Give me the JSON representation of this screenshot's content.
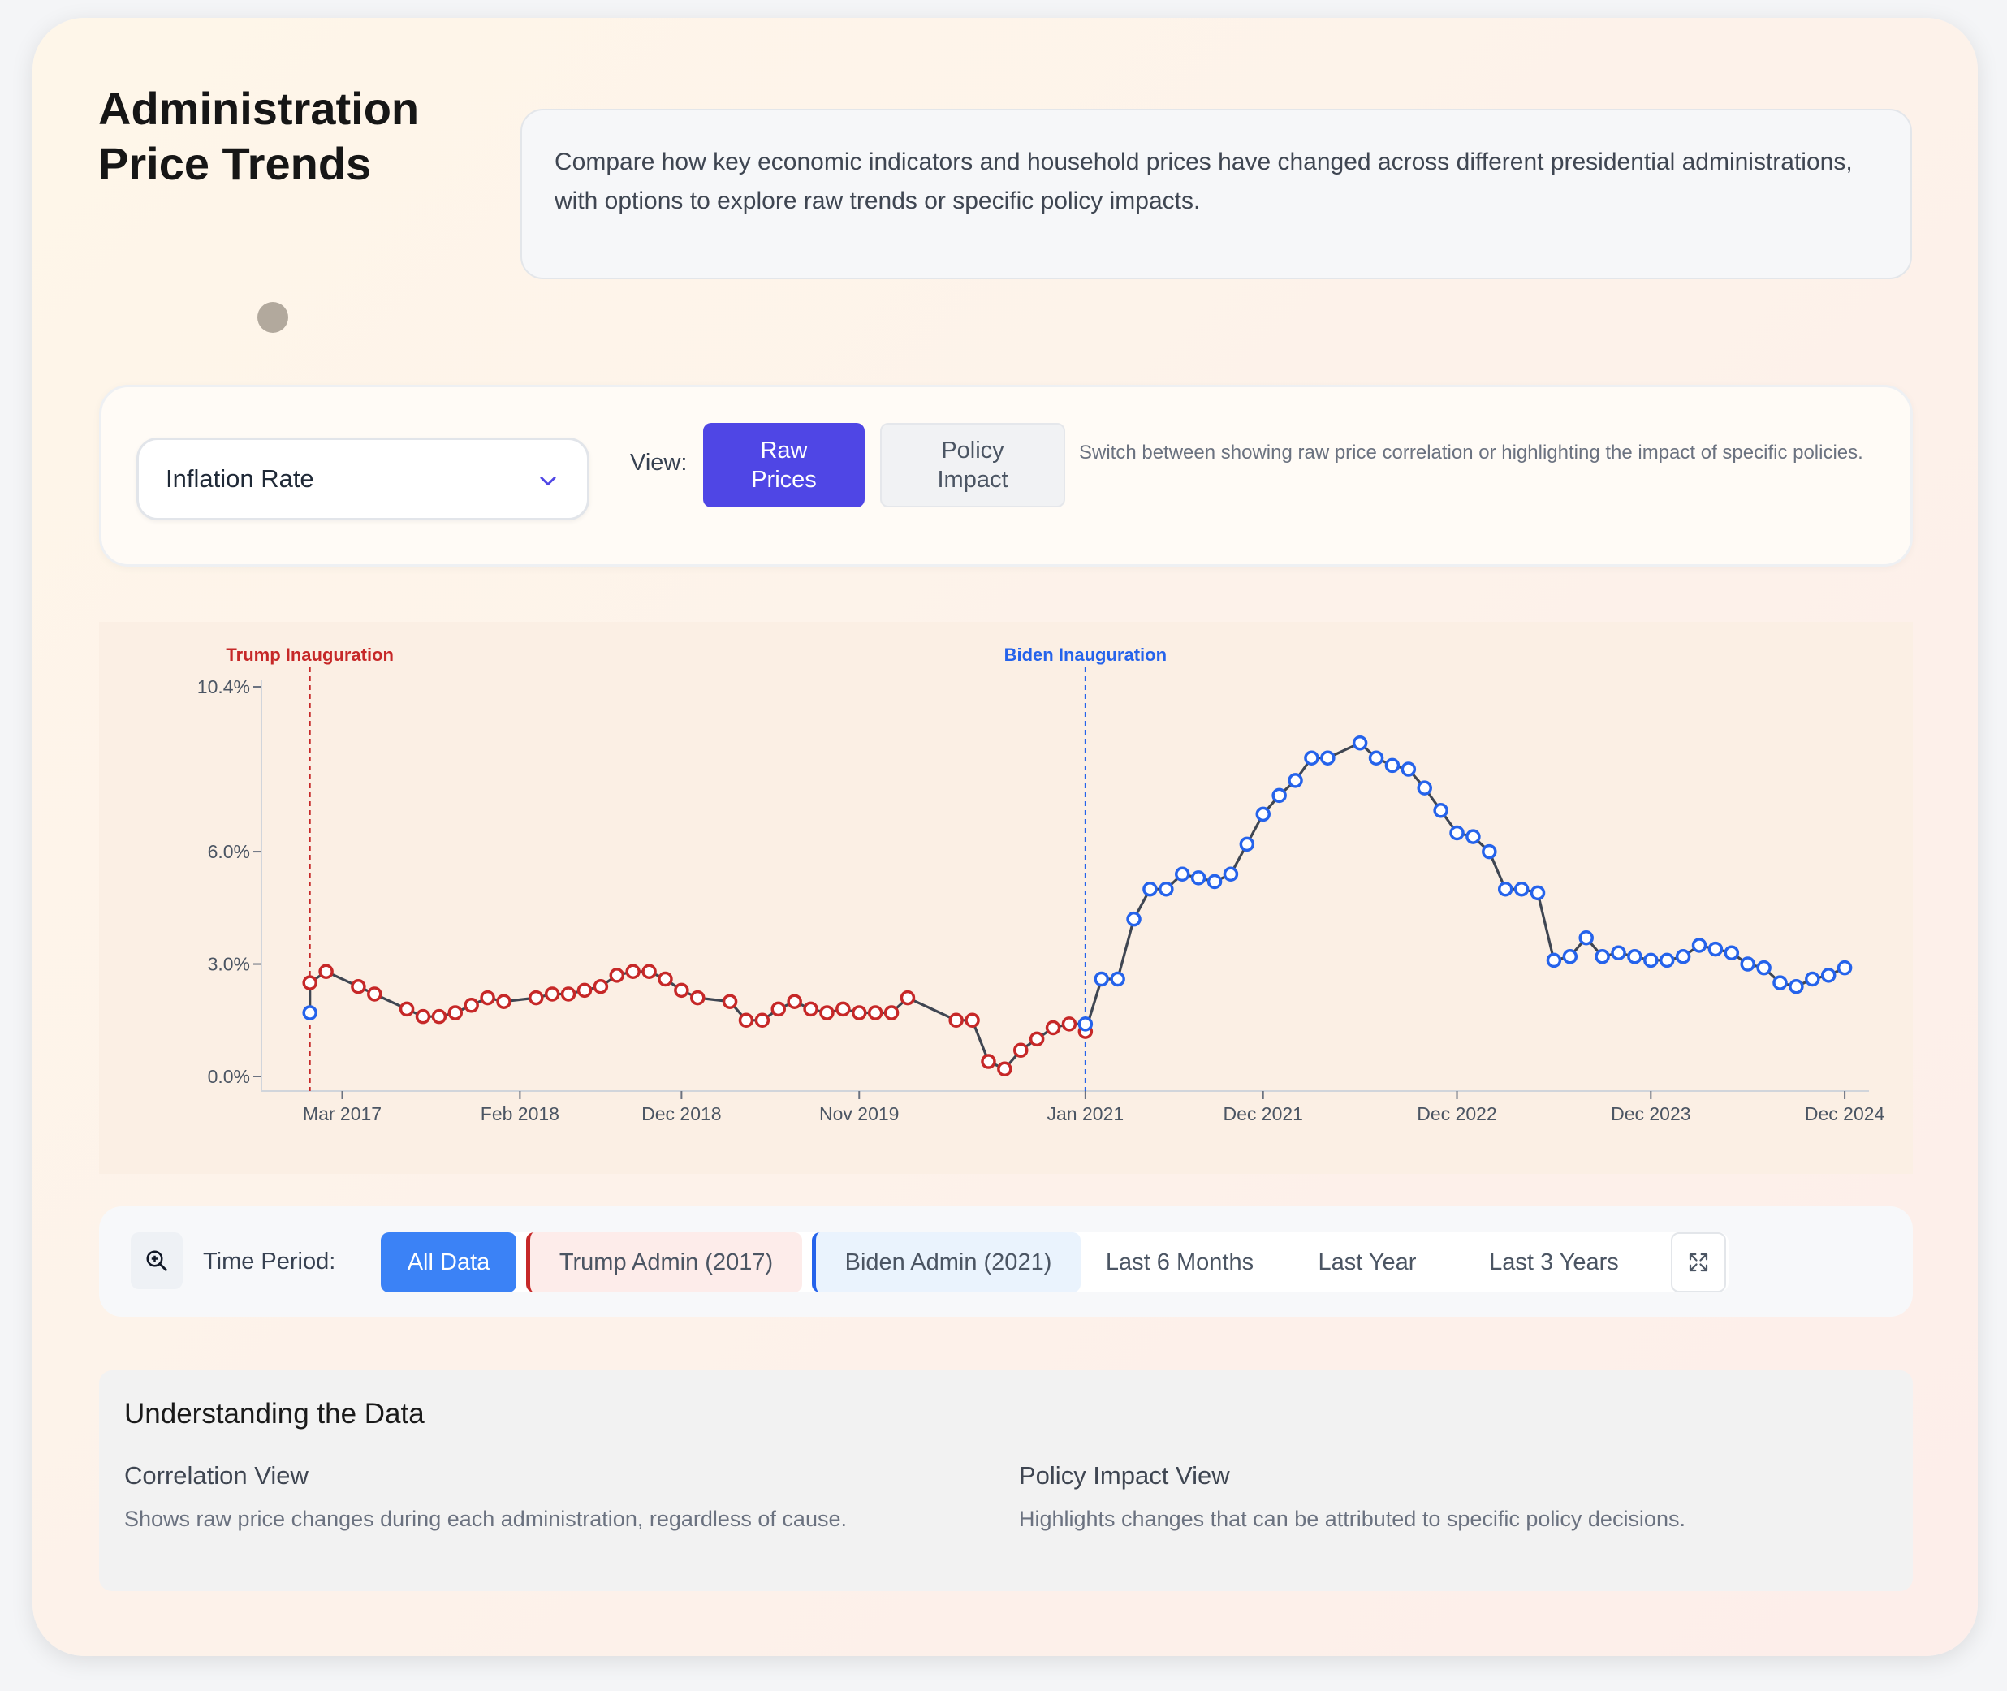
{
  "header": {
    "title_line1": "Administration",
    "title_line2": "Price Trends",
    "description": "Compare how key economic indicators and household prices have changed across different presidential administrations, with options to explore raw trends or specific policy impacts."
  },
  "controls": {
    "indicator_selected": "Inflation Rate",
    "view_label": "View:",
    "view_raw_label": "Raw\nPrices",
    "view_policy_label": "Policy\nImpact",
    "view_hint": "Switch between showing raw price correlation or highlighting the impact of specific policies."
  },
  "colors": {
    "trump": "#c62828",
    "biden": "#2563eb",
    "line": "#3f4652",
    "accent": "#4f46e5",
    "period_active": "#3b82f6"
  },
  "chart_data": {
    "type": "line",
    "title": "",
    "xlabel": "",
    "ylabel": "",
    "ylim": [
      0,
      10.4
    ],
    "y_ticks": [
      "0.0%",
      "3.0%",
      "6.0%",
      "10.4%"
    ],
    "y_tick_values": [
      0,
      3,
      6,
      10.4
    ],
    "x_ticks": [
      "Mar 2017",
      "Feb 2018",
      "Dec 2018",
      "Nov 2019",
      "Jan 2021",
      "Dec 2021",
      "Dec 2022",
      "Dec 2023",
      "Dec 2024"
    ],
    "x_tick_months": [
      "2017-03",
      "2018-02",
      "2018-12",
      "2019-11",
      "2021-01",
      "2021-12",
      "2022-12",
      "2023-12",
      "2024-12"
    ],
    "grid": false,
    "annotations": [
      {
        "label": "Trump Inauguration",
        "date": "2017-01",
        "color": "trump"
      },
      {
        "label": "Biden Inauguration",
        "date": "2021-01",
        "color": "biden"
      }
    ],
    "series": [
      {
        "admin": "trump",
        "points": [
          [
            "2017-01",
            2.5
          ],
          [
            "2017-02",
            2.8
          ],
          [
            "2017-04",
            2.4
          ],
          [
            "2017-05",
            2.2
          ],
          [
            "2017-07",
            1.8
          ],
          [
            "2017-08",
            1.6
          ],
          [
            "2017-09",
            1.6
          ],
          [
            "2017-10",
            1.7
          ],
          [
            "2017-11",
            1.9
          ],
          [
            "2017-12",
            2.1
          ],
          [
            "2018-01",
            2.0
          ],
          [
            "2018-03",
            2.1
          ],
          [
            "2018-04",
            2.2
          ],
          [
            "2018-05",
            2.2
          ],
          [
            "2018-06",
            2.3
          ],
          [
            "2018-07",
            2.4
          ],
          [
            "2018-08",
            2.7
          ],
          [
            "2018-09",
            2.8
          ],
          [
            "2018-10",
            2.8
          ],
          [
            "2018-11",
            2.6
          ],
          [
            "2018-12",
            2.3
          ],
          [
            "2019-01",
            2.1
          ],
          [
            "2019-03",
            2.0
          ],
          [
            "2019-04",
            1.5
          ],
          [
            "2019-05",
            1.5
          ],
          [
            "2019-06",
            1.8
          ],
          [
            "2019-07",
            2.0
          ],
          [
            "2019-08",
            1.8
          ],
          [
            "2019-09",
            1.7
          ],
          [
            "2019-10",
            1.8
          ],
          [
            "2019-11",
            1.7
          ],
          [
            "2019-12",
            1.7
          ],
          [
            "2020-01",
            1.7
          ],
          [
            "2020-02",
            2.1
          ],
          [
            "2020-05",
            1.5
          ],
          [
            "2020-06",
            1.5
          ],
          [
            "2020-07",
            0.4
          ],
          [
            "2020-08",
            0.2
          ],
          [
            "2020-09",
            0.7
          ],
          [
            "2020-10",
            1.0
          ],
          [
            "2020-11",
            1.3
          ],
          [
            "2020-12",
            1.4
          ],
          [
            "2021-01",
            1.2
          ]
        ]
      },
      {
        "admin": "biden",
        "points": [
          [
            "2017-01",
            1.7
          ],
          [
            "2021-01",
            1.4
          ],
          [
            "2021-02",
            2.6
          ],
          [
            "2021-03",
            2.6
          ],
          [
            "2021-04",
            4.2
          ],
          [
            "2021-05",
            5.0
          ],
          [
            "2021-06",
            5.0
          ],
          [
            "2021-07",
            5.4
          ],
          [
            "2021-08",
            5.3
          ],
          [
            "2021-09",
            5.2
          ],
          [
            "2021-10",
            5.4
          ],
          [
            "2021-11",
            6.2
          ],
          [
            "2021-12",
            7.0
          ],
          [
            "2022-01",
            7.5
          ],
          [
            "2022-02",
            7.9
          ],
          [
            "2022-03",
            8.5
          ],
          [
            "2022-04",
            8.5
          ],
          [
            "2022-06",
            8.9
          ],
          [
            "2022-07",
            8.5
          ],
          [
            "2022-08",
            8.3
          ],
          [
            "2022-09",
            8.2
          ],
          [
            "2022-10",
            7.7
          ],
          [
            "2022-11",
            7.1
          ],
          [
            "2022-12",
            6.5
          ],
          [
            "2023-01",
            6.4
          ],
          [
            "2023-02",
            6.0
          ],
          [
            "2023-03",
            5.0
          ],
          [
            "2023-04",
            5.0
          ],
          [
            "2023-05",
            4.9
          ],
          [
            "2023-06",
            3.1
          ],
          [
            "2023-07",
            3.2
          ],
          [
            "2023-08",
            3.7
          ],
          [
            "2023-09",
            3.2
          ],
          [
            "2023-10",
            3.3
          ],
          [
            "2023-11",
            3.2
          ],
          [
            "2023-12",
            3.1
          ],
          [
            "2024-01",
            3.1
          ],
          [
            "2024-02",
            3.2
          ],
          [
            "2024-03",
            3.5
          ],
          [
            "2024-04",
            3.4
          ],
          [
            "2024-05",
            3.3
          ],
          [
            "2024-06",
            3.0
          ],
          [
            "2024-07",
            2.9
          ],
          [
            "2024-08",
            2.5
          ],
          [
            "2024-09",
            2.4
          ],
          [
            "2024-10",
            2.6
          ],
          [
            "2024-11",
            2.7
          ],
          [
            "2024-12",
            2.9
          ]
        ]
      }
    ]
  },
  "time_period": {
    "label": "Time Period:",
    "options": [
      "All Data",
      "Trump Admin (2017)",
      "Biden Admin (2021)",
      "Last 6 Months",
      "Last Year",
      "Last 3 Years"
    ],
    "selected": "All Data",
    "zoom_icon": "zoom-in-icon",
    "expand_icon": "expand-icon"
  },
  "understanding": {
    "title": "Understanding the Data",
    "correlation_title": "Correlation View",
    "correlation_text": "Shows raw price changes during each administration, regardless of cause.",
    "policy_title": "Policy Impact View",
    "policy_text": "Highlights changes that can be attributed to specific policy decisions."
  }
}
